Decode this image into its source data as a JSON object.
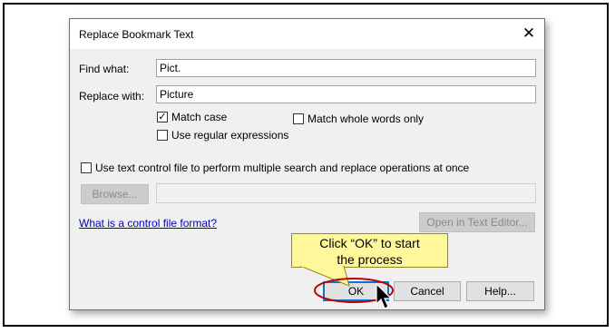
{
  "dialog": {
    "title": "Replace Bookmark Text",
    "close_icon": "close-icon",
    "find_label": "Find what:",
    "find_value": "Pict.",
    "replace_label": "Replace with:",
    "replace_value": "Picture",
    "match_case": {
      "label": "Match case",
      "checked": true
    },
    "regex": {
      "label": "Use regular expressions",
      "checked": false
    },
    "whole_words": {
      "label": "Match whole words only",
      "checked": false
    },
    "control_file": {
      "label": "Use text control file to perform multiple search and replace operations at once",
      "checked": false
    },
    "browse_label": "Browse...",
    "control_file_path": "",
    "help_link": "What is a control file format?",
    "open_editor_label": "Open in Text Editor...",
    "ok_label": "OK",
    "cancel_label": "Cancel",
    "help_label": "Help..."
  },
  "callout": {
    "line1": "Click “OK” to start",
    "line2": "the process",
    "color": "#fff89a"
  },
  "highlight_color": "#c00000",
  "accent_color": "#0078d7"
}
